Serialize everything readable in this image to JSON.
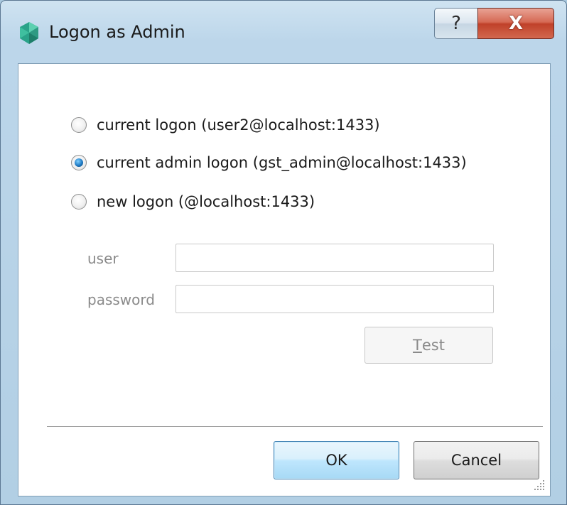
{
  "window": {
    "title": "Logon as Admin",
    "help_button": "?",
    "close_button": "X"
  },
  "options": [
    {
      "label": "current logon (user2@localhost:1433)",
      "checked": false
    },
    {
      "label": "current admin logon (gst_admin@localhost:1433)",
      "checked": true
    },
    {
      "label": "new logon (@localhost:1433)",
      "checked": false
    }
  ],
  "form": {
    "user_label": "user",
    "user_value": "",
    "password_label": "password",
    "password_value": "",
    "test_button": "Test",
    "test_mnemonic": "T",
    "test_rest": "est"
  },
  "footer": {
    "ok_button": "OK",
    "cancel_button": "Cancel"
  },
  "colors": {
    "frame": "#b2cfe4",
    "close_red": "#c0412a",
    "ok_blue": "#bee6fd"
  }
}
